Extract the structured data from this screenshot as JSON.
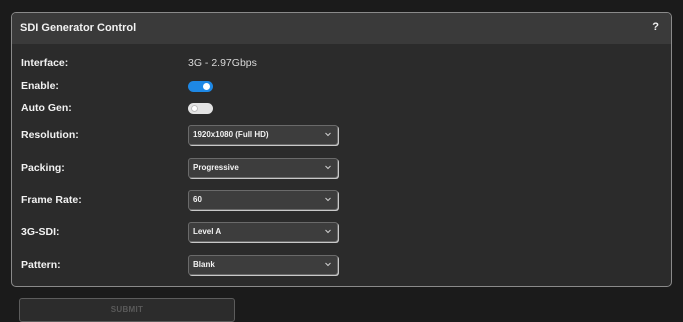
{
  "panel": {
    "title": "SDI Generator Control",
    "help_label": "?"
  },
  "fields": {
    "interface": {
      "label": "Interface:",
      "value": "3G - 2.97Gbps"
    },
    "enable": {
      "label": "Enable:",
      "state": "on"
    },
    "auto_gen": {
      "label": "Auto Gen:",
      "state": "off"
    },
    "resolution": {
      "label": "Resolution:",
      "value": "1920x1080 (Full HD)"
    },
    "packing": {
      "label": "Packing:",
      "value": "Progressive"
    },
    "frame_rate": {
      "label": "Frame Rate:",
      "value": "60"
    },
    "sdi_level": {
      "label": "3G-SDI:",
      "value": "Level A"
    },
    "pattern": {
      "label": "Pattern:",
      "value": "Blank"
    }
  },
  "submit": {
    "label": "SUBMIT"
  },
  "colors": {
    "accent": "#1e88e5",
    "panel_bg": "#2b2b2b",
    "header_bg": "#3a3a3a",
    "page_bg": "#1b1b1b"
  },
  "icons": {
    "dropdown": "chevron-down-icon",
    "help": "help-icon"
  }
}
